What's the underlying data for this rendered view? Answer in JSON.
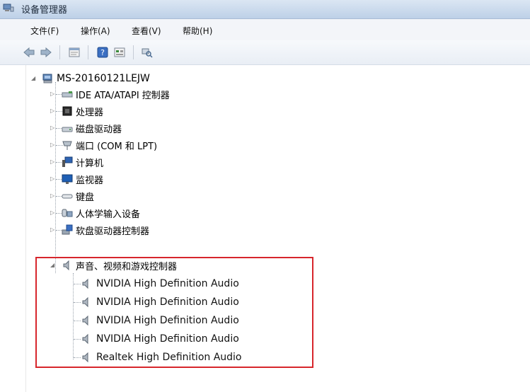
{
  "window": {
    "title": "设备管理器",
    "icon": "device-manager-icon"
  },
  "menu": [
    {
      "label": "文件(F)"
    },
    {
      "label": "操作(A)"
    },
    {
      "label": "查看(V)"
    },
    {
      "label": "帮助(H)"
    }
  ],
  "toolbar": {
    "buttons": [
      "back-arrow-icon",
      "forward-arrow-icon",
      "properties-icon",
      "help-icon",
      "view-icon",
      "scan-hardware-icon"
    ]
  },
  "tree": {
    "root": {
      "label": "MS-20160121LEJW",
      "icon": "computer-tree-icon",
      "expanded": true
    },
    "categories": [
      {
        "label": "IDE ATA/ATAPI 控制器",
        "icon": "ide-controller-icon"
      },
      {
        "label": "处理器",
        "icon": "processor-icon"
      },
      {
        "label": "磁盘驱动器",
        "icon": "disk-drive-icon"
      },
      {
        "label": "端口 (COM 和 LPT)",
        "icon": "port-icon"
      },
      {
        "label": "计算机",
        "icon": "computer-icon"
      },
      {
        "label": "监视器",
        "icon": "monitor-icon"
      },
      {
        "label": "键盘",
        "icon": "keyboard-icon"
      },
      {
        "label": "人体学输入设备",
        "icon": "hid-icon"
      },
      {
        "label": "软盘驱动器控制器",
        "icon": "floppy-controller-icon"
      }
    ],
    "audio_category": {
      "label": "声音、视频和游戏控制器",
      "icon": "speaker-icon",
      "expanded": true,
      "children": [
        {
          "label": "NVIDIA High Definition Audio"
        },
        {
          "label": "NVIDIA High Definition Audio"
        },
        {
          "label": "NVIDIA High Definition Audio"
        },
        {
          "label": "NVIDIA High Definition Audio"
        },
        {
          "label": "Realtek High Definition Audio"
        }
      ]
    },
    "highlight_color": "#d7262c"
  }
}
